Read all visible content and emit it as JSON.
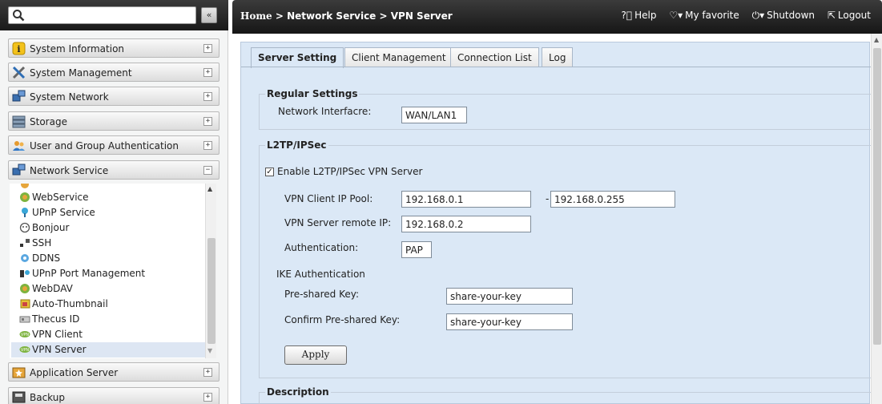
{
  "search": {
    "placeholder": "",
    "collapse_label": "«"
  },
  "sidebar": {
    "groups": [
      {
        "label": "System Information",
        "icon": "info-icon",
        "toggle": "+"
      },
      {
        "label": "System Management",
        "icon": "tools-icon",
        "toggle": "+"
      },
      {
        "label": "System Network",
        "icon": "network-icon",
        "toggle": "+"
      },
      {
        "label": "Storage",
        "icon": "storage-icon",
        "toggle": "+"
      },
      {
        "label": "User and Group Authentication",
        "icon": "users-icon",
        "toggle": "+"
      },
      {
        "label": "Network Service",
        "icon": "network-service-icon",
        "toggle": "−"
      },
      {
        "label": "Application Server",
        "icon": "app-server-icon",
        "toggle": "+"
      },
      {
        "label": "Backup",
        "icon": "backup-icon",
        "toggle": "+"
      }
    ],
    "network_items": [
      {
        "label": "WebService",
        "icon": "webservice-icon"
      },
      {
        "label": "UPnP Service",
        "icon": "upnp-icon"
      },
      {
        "label": "Bonjour",
        "icon": "bonjour-icon"
      },
      {
        "label": "SSH",
        "icon": "ssh-icon"
      },
      {
        "label": "DDNS",
        "icon": "ddns-icon"
      },
      {
        "label": "UPnP Port Management",
        "icon": "upnp-port-icon"
      },
      {
        "label": "WebDAV",
        "icon": "webdav-icon"
      },
      {
        "label": "Auto-Thumbnail",
        "icon": "thumbnail-icon"
      },
      {
        "label": "Thecus ID",
        "icon": "thecus-id-icon"
      },
      {
        "label": "VPN Client",
        "icon": "vpn-icon"
      },
      {
        "label": "VPN Server",
        "icon": "vpn-icon",
        "selected": true
      }
    ]
  },
  "header": {
    "breadcrumb": {
      "home": "Home",
      "sep1": " > ",
      "section": "Network Service",
      "sep2": " > ",
      "page": "VPN Server"
    },
    "actions": {
      "help": "Help",
      "favorite": "My favorite",
      "shutdown": "Shutdown",
      "logout": "Logout"
    }
  },
  "tabs": [
    "Server Setting",
    "Client Management",
    "Connection List",
    "Log"
  ],
  "regular": {
    "title": "Regular Settings",
    "interface_label": "Network Interfacre:",
    "interface_value": "WAN/LAN1"
  },
  "l2tp": {
    "title": "L2TP/IPSec",
    "enable_label": "Enable L2TP/IPSec VPN Server",
    "enable_checked": true,
    "pool_label": "VPN Client IP Pool:",
    "pool_start": "192.168.0.1",
    "pool_sep": "-",
    "pool_end": "192.168.0.255",
    "remote_label": "VPN Server remote IP:",
    "remote_value": "192.168.0.2",
    "auth_label": "Authentication:",
    "auth_value": "PAP",
    "ike_title": "IKE Authentication",
    "psk_label": "Pre-shared Key:",
    "psk_value": "share-your-key",
    "psk_confirm_label": "Confirm Pre-shared Key:",
    "psk_confirm_value": "share-your-key",
    "apply_label": "Apply"
  },
  "description": {
    "title": "Description"
  },
  "colors": {
    "panel_bg": "#dbe8f6",
    "topbar_bg": "#1e1e1e",
    "selected_row": "#dde6f3"
  }
}
